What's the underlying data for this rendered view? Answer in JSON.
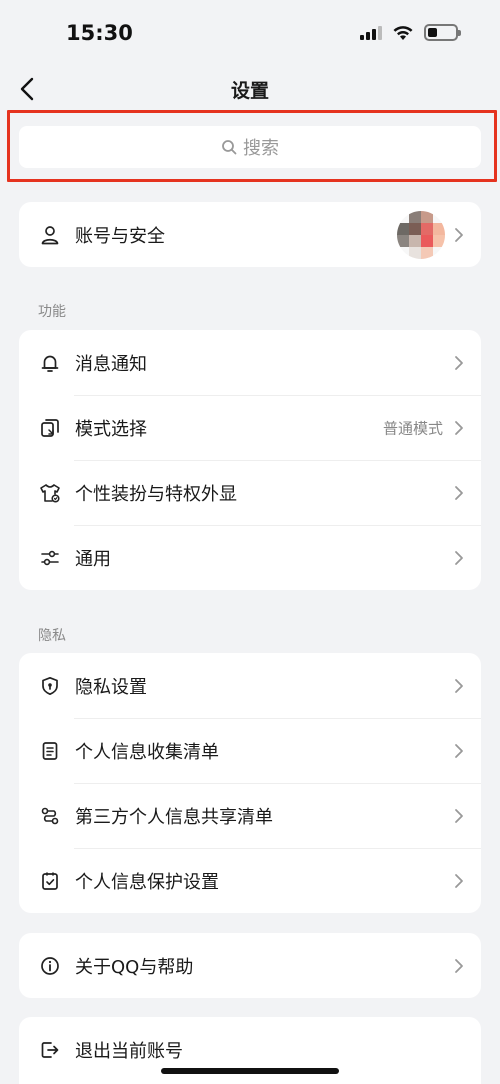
{
  "status_bar": {
    "time": "15:30",
    "icons": [
      "signal-icon",
      "wifi-icon",
      "battery-icon"
    ]
  },
  "nav": {
    "title": "设置",
    "back_icon": "chevron-left-icon"
  },
  "search": {
    "placeholder": "搜索",
    "icon": "search-icon"
  },
  "account": {
    "label": "账号与安全",
    "icon": "user-icon"
  },
  "sections": {
    "features": {
      "title": "功能",
      "items": [
        {
          "label": "消息通知",
          "icon": "bell-icon",
          "value": ""
        },
        {
          "label": "模式选择",
          "icon": "mode-icon",
          "value": "普通模式"
        },
        {
          "label": "个性装扮与特权外显",
          "icon": "shirt-icon",
          "value": ""
        },
        {
          "label": "通用",
          "icon": "sliders-icon",
          "value": ""
        }
      ]
    },
    "privacy": {
      "title": "隐私",
      "items": [
        {
          "label": "隐私设置",
          "icon": "shield-icon"
        },
        {
          "label": "个人信息收集清单",
          "icon": "document-icon"
        },
        {
          "label": "第三方个人信息共享清单",
          "icon": "share-icon"
        },
        {
          "label": "个人信息保护设置",
          "icon": "checkbox-icon"
        }
      ]
    }
  },
  "about": {
    "label": "关于QQ与帮助",
    "icon": "info-icon"
  },
  "logout": {
    "label": "退出当前账号",
    "icon": "logout-icon"
  },
  "colors": {
    "background": "#f2f3f5",
    "card": "#ffffff",
    "highlight_border": "#e5331f",
    "secondary_text": "#888888"
  }
}
